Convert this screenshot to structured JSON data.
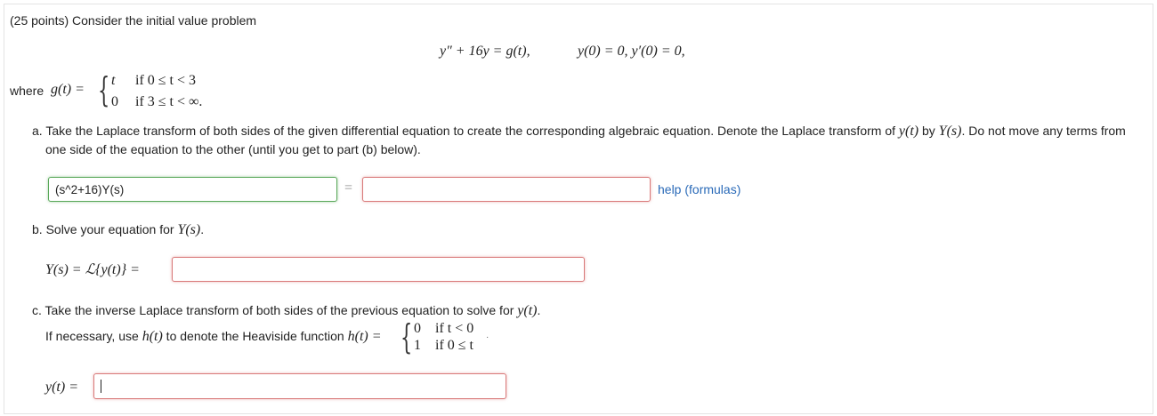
{
  "header": {
    "intro": "(25 points) Consider the initial value problem"
  },
  "ivp": {
    "ode": "y″ + 16y = g(t),",
    "ic": "y(0) = 0,   y′(0) = 0,"
  },
  "piecewise_g": {
    "where_label": "where",
    "lhs": "g(t) =",
    "cases": [
      {
        "value": "t",
        "condition": "if 0 ≤ t < 3"
      },
      {
        "value": "0",
        "condition": "if 3 ≤ t < ∞."
      }
    ]
  },
  "part_a": {
    "text_line1_pre": "a. Take the Laplace transform of both sides of the given differential equation to create the corresponding algebraic equation. Denote the Laplace transform of ",
    "y_of_t": "y(t)",
    "by": " by ",
    "Y_of_s": "Y(s)",
    "text_line1_post": ". Do not move any terms from",
    "text_line2": "one side of the equation to the other (until you get to part (b) below).",
    "lhs_value": "(s^2+16)Y(s)",
    "equals": "=",
    "rhs_value": "",
    "help_link": "help (formulas)"
  },
  "part_b": {
    "text_pre": "b. Solve your equation for ",
    "Y_of_s": "Y(s)",
    "text_post": ".",
    "lhs": "Y(s) = ℒ{y(t)} =",
    "value": ""
  },
  "part_c": {
    "text_pre": "c. Take the inverse Laplace transform of both sides of the previous equation to solve for ",
    "y_of_t": "y(t)",
    "text_post": ".",
    "heaviside_pre": "If necessary, use ",
    "h_of_t": "h(t)",
    "heaviside_mid": " to denote the Heaviside function ",
    "h_lhs": "h(t) =",
    "cases": [
      {
        "value": "0",
        "condition": "if t < 0"
      },
      {
        "value": "1",
        "condition": "if 0 ≤ t"
      }
    ],
    "trail": "·",
    "lhs": "y(t) =",
    "value": ""
  }
}
